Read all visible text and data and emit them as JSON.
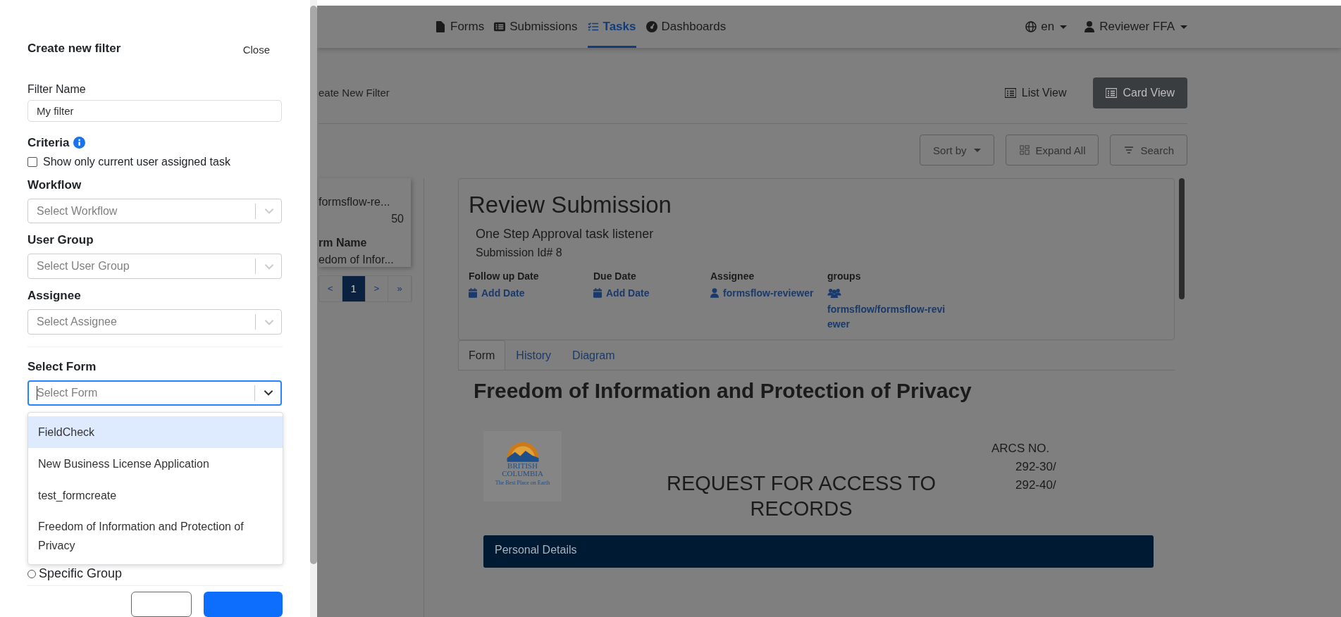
{
  "drawer": {
    "title": "Create new filter",
    "close": "Close",
    "filter_name": {
      "label": "Filter Name",
      "value": "My filter"
    },
    "criteria": {
      "label": "Criteria",
      "checkbox": {
        "label": "Show only current user assigned task",
        "checked": false
      }
    },
    "fields": [
      {
        "label": "Workflow",
        "placeholder": "Select Workflow",
        "focused": false
      },
      {
        "label": "User Group",
        "placeholder": "Select User Group",
        "focused": false
      },
      {
        "label": "Assignee",
        "placeholder": "Select Assignee",
        "focused": false
      },
      {
        "label": "Select Form",
        "placeholder": "Select Form",
        "focused": true
      }
    ],
    "dropdown_options": [
      {
        "label": "FieldCheck",
        "selected": true
      },
      {
        "label": "New Business License Application",
        "selected": false
      },
      {
        "label": "test_formcreate",
        "selected": false
      },
      {
        "label": "Freedom of Information and Protection of Privacy",
        "selected": false
      }
    ],
    "radio": {
      "label": "Specific Group",
      "selected": false
    }
  },
  "nav": {
    "items": [
      {
        "label": "Forms",
        "selected": false
      },
      {
        "label": "Submissions",
        "selected": false
      },
      {
        "label": "Tasks",
        "selected": true
      },
      {
        "label": "Dashboards",
        "selected": false
      }
    ],
    "language": "en",
    "user": "Reviewer FFA"
  },
  "toolbar": {
    "filter_link": "eate New Filter",
    "views": [
      {
        "label": "List View",
        "selected": false
      },
      {
        "label": "Card View",
        "selected": true
      }
    ],
    "sort": "Sort by",
    "expand": "Expand All",
    "search": "Search"
  },
  "task_card": {
    "assignee": "formsflow-re...",
    "count": "50",
    "form_label": "rm Name",
    "form_value": "edom of Infor..."
  },
  "pagination": [
    {
      "label": "<",
      "kind": "nav",
      "selected": false
    },
    {
      "label": "1",
      "kind": "page",
      "selected": true
    },
    {
      "label": ">",
      "kind": "nav",
      "selected": false
    },
    {
      "label": "»",
      "kind": "nav",
      "selected": false
    }
  ],
  "detail": {
    "title": "Review Submission",
    "task": "One Step Approval task listener",
    "submission": "Submission Id# 8",
    "columns": [
      {
        "label": "Follow up Date",
        "value": "Add Date"
      },
      {
        "label": "Due Date",
        "value": "Add Date"
      },
      {
        "label": "Assignee",
        "value": "formsflow-reviewer"
      },
      {
        "label": "groups",
        "value": "formsflow/formsflow-reviewer"
      }
    ],
    "tabs": [
      {
        "label": "Form",
        "selected": true
      },
      {
        "label": "History",
        "selected": false
      },
      {
        "label": "Diagram",
        "selected": false
      }
    ]
  },
  "form": {
    "title": "Freedom of Information and Protection of Privacy",
    "logo": [
      "BRITISH",
      "COLUMBIA",
      "The Best Place on Earth"
    ],
    "arcs": [
      "ARCS NO.",
      "292-30/",
      "292-40/"
    ],
    "heading": "REQUEST FOR ACCESS TO RECORDS",
    "section": "Personal Details"
  }
}
